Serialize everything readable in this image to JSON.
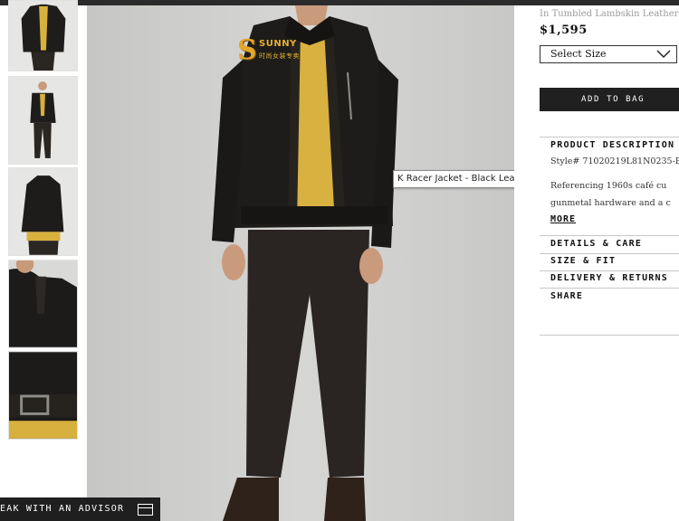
{
  "product": {
    "subtitle": "In Tumbled Lambskin Leather",
    "price": "$1,595",
    "size_select": "Select Size",
    "add_to_bag": "ADD TO BAG"
  },
  "description": {
    "heading": "PRODUCT DESCRIPTION",
    "style": "Style# 71020219L81N0235-B",
    "lines": [
      "Referencing 1960s café cu",
      "gunmetal hardware and a c"
    ],
    "more": "MORE"
  },
  "accordion": [
    "DETAILS & CARE",
    "SIZE & FIT",
    "DELIVERY & RETURNS",
    "SHARE"
  ],
  "image": {
    "tooltip": "K Racer Jacket - Black Leather Jackets"
  },
  "watermark": {
    "letter": "S",
    "name": "SUNNY",
    "sub": "时尚女装专卖店"
  },
  "advisor": {
    "label": "EAK WITH AN ADVISOR"
  },
  "icons": {
    "chevron": "chevron-down-icon",
    "advisor": "chat-window-icon"
  },
  "colors": {
    "background": "#d2d2d0",
    "jacket": "#1e1c1a",
    "sweater": "#d9b140",
    "button": "#202020"
  }
}
